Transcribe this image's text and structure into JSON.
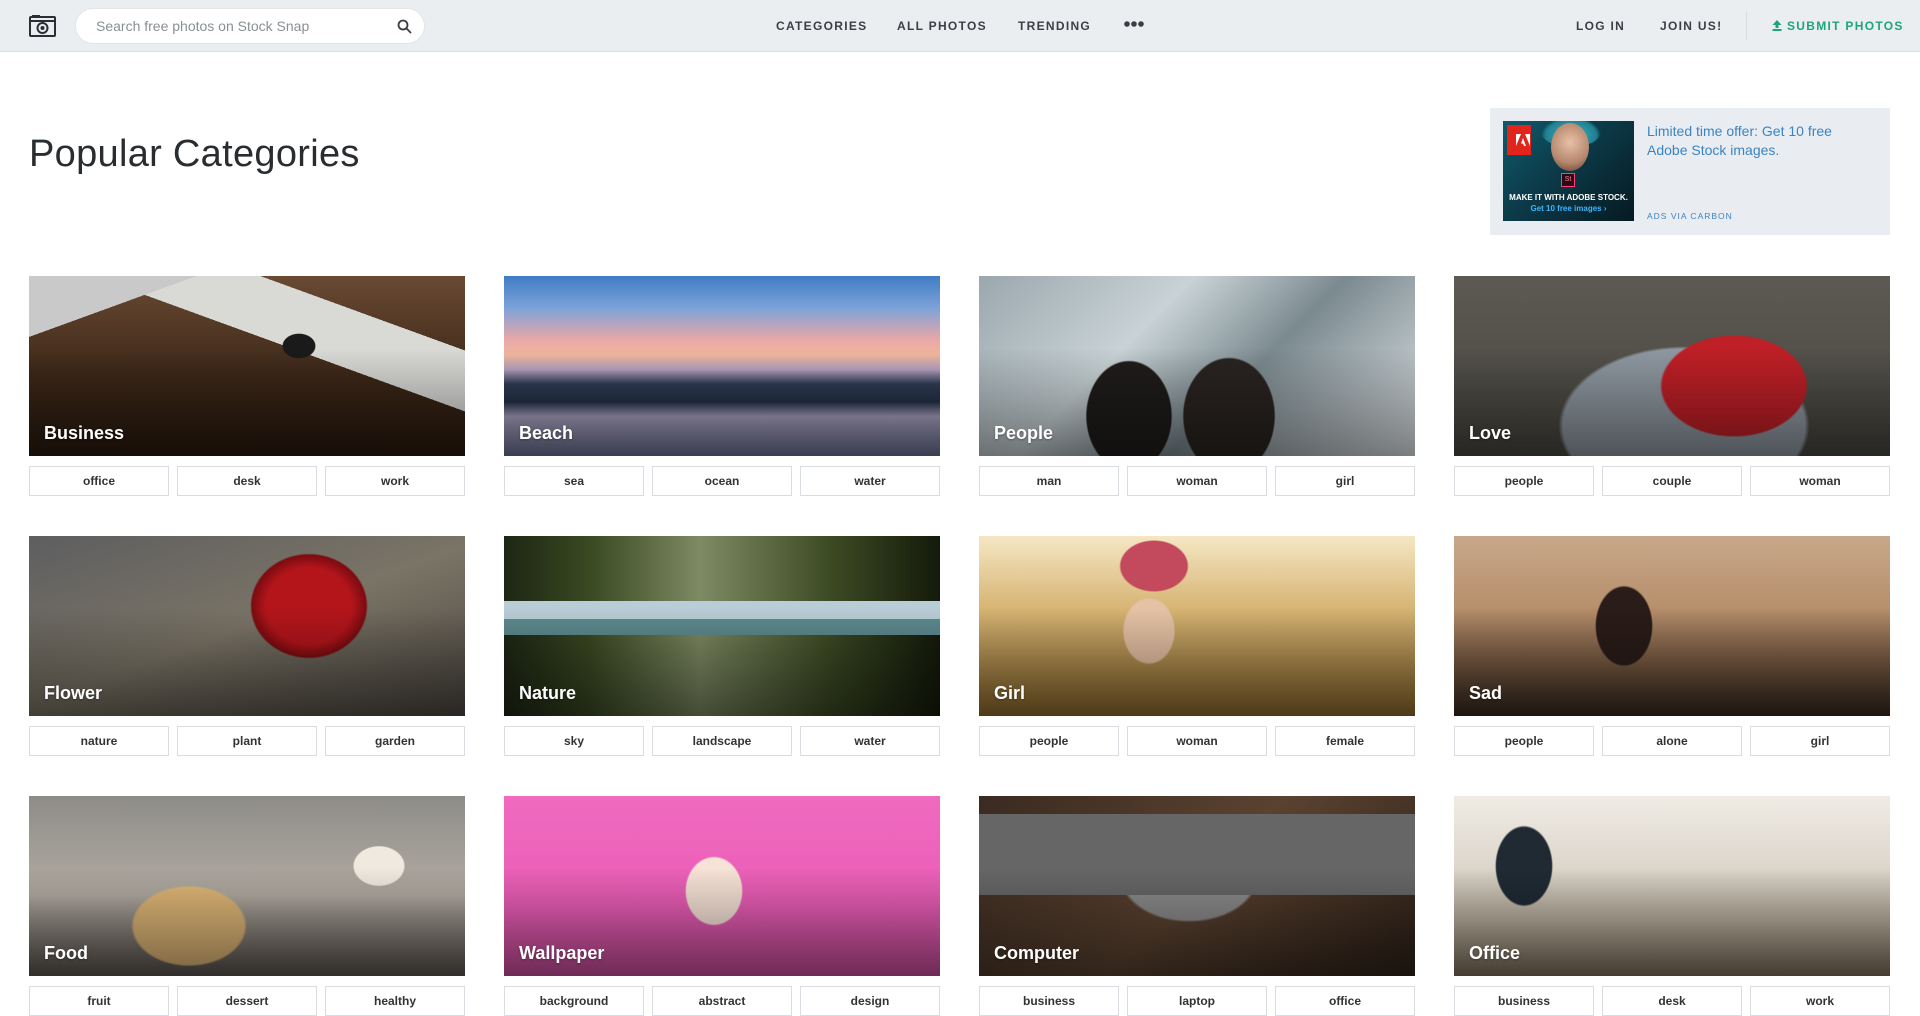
{
  "header": {
    "logo_icon": "camera-icon",
    "search": {
      "placeholder": "Search free photos on Stock Snap",
      "value": ""
    },
    "nav": [
      {
        "label": "CATEGORIES"
      },
      {
        "label": "ALL PHOTOS"
      },
      {
        "label": "TRENDING"
      }
    ],
    "more_icon": "ellipsis-icon",
    "login_label": "LOG IN",
    "join_label": "JOIN US!",
    "submit_label": "SUBMIT PHOTOS",
    "colors": {
      "background": "#ebeef1",
      "submit": "#1fa47a"
    }
  },
  "main": {
    "title": "Popular Categories",
    "ad": {
      "image_line1": "MAKE IT WITH ADOBE STOCK.",
      "image_line2": "Get 10 free images ›",
      "image_badge": "St",
      "image_brand": "Adobe",
      "text": "Limited time offer: Get 10 free Adobe Stock images.",
      "via": "ADS VIA CARBON",
      "link_color": "#3b84c4"
    },
    "categories": [
      {
        "title": "Business",
        "tags": [
          "office",
          "desk",
          "work"
        ]
      },
      {
        "title": "Beach",
        "tags": [
          "sea",
          "ocean",
          "water"
        ]
      },
      {
        "title": "People",
        "tags": [
          "man",
          "woman",
          "girl"
        ]
      },
      {
        "title": "Love",
        "tags": [
          "people",
          "couple",
          "woman"
        ]
      },
      {
        "title": "Flower",
        "tags": [
          "nature",
          "plant",
          "garden"
        ]
      },
      {
        "title": "Nature",
        "tags": [
          "sky",
          "landscape",
          "water"
        ]
      },
      {
        "title": "Girl",
        "tags": [
          "people",
          "woman",
          "female"
        ]
      },
      {
        "title": "Sad",
        "tags": [
          "people",
          "alone",
          "girl"
        ]
      },
      {
        "title": "Food",
        "tags": [
          "fruit",
          "dessert",
          "healthy"
        ]
      },
      {
        "title": "Wallpaper",
        "tags": [
          "background",
          "abstract",
          "design"
        ]
      },
      {
        "title": "Computer",
        "tags": [
          "business",
          "laptop",
          "office"
        ]
      },
      {
        "title": "Office",
        "tags": [
          "business",
          "desk",
          "work"
        ]
      }
    ]
  }
}
